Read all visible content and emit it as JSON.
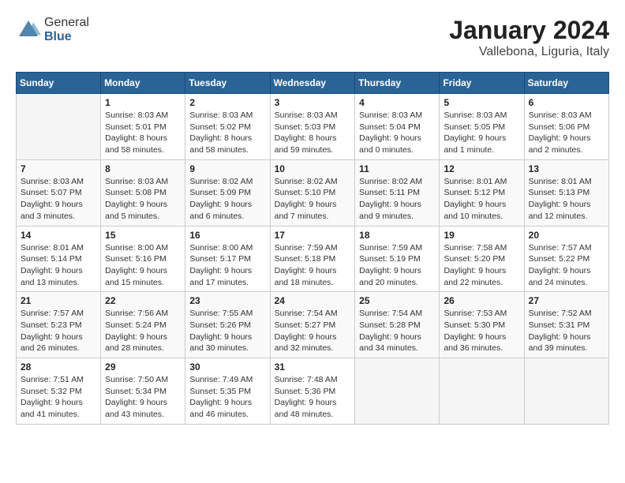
{
  "logo": {
    "general": "General",
    "blue": "Blue"
  },
  "title": "January 2024",
  "location": "Vallebona, Liguria, Italy",
  "days_of_week": [
    "Sunday",
    "Monday",
    "Tuesday",
    "Wednesday",
    "Thursday",
    "Friday",
    "Saturday"
  ],
  "weeks": [
    [
      {
        "day": "",
        "info": ""
      },
      {
        "day": "1",
        "info": "Sunrise: 8:03 AM\nSunset: 5:01 PM\nDaylight: 8 hours\nand 58 minutes."
      },
      {
        "day": "2",
        "info": "Sunrise: 8:03 AM\nSunset: 5:02 PM\nDaylight: 8 hours\nand 58 minutes."
      },
      {
        "day": "3",
        "info": "Sunrise: 8:03 AM\nSunset: 5:03 PM\nDaylight: 8 hours\nand 59 minutes."
      },
      {
        "day": "4",
        "info": "Sunrise: 8:03 AM\nSunset: 5:04 PM\nDaylight: 9 hours\nand 0 minutes."
      },
      {
        "day": "5",
        "info": "Sunrise: 8:03 AM\nSunset: 5:05 PM\nDaylight: 9 hours\nand 1 minute."
      },
      {
        "day": "6",
        "info": "Sunrise: 8:03 AM\nSunset: 5:06 PM\nDaylight: 9 hours\nand 2 minutes."
      }
    ],
    [
      {
        "day": "7",
        "info": "Sunrise: 8:03 AM\nSunset: 5:07 PM\nDaylight: 9 hours\nand 3 minutes."
      },
      {
        "day": "8",
        "info": "Sunrise: 8:03 AM\nSunset: 5:08 PM\nDaylight: 9 hours\nand 5 minutes."
      },
      {
        "day": "9",
        "info": "Sunrise: 8:02 AM\nSunset: 5:09 PM\nDaylight: 9 hours\nand 6 minutes."
      },
      {
        "day": "10",
        "info": "Sunrise: 8:02 AM\nSunset: 5:10 PM\nDaylight: 9 hours\nand 7 minutes."
      },
      {
        "day": "11",
        "info": "Sunrise: 8:02 AM\nSunset: 5:11 PM\nDaylight: 9 hours\nand 9 minutes."
      },
      {
        "day": "12",
        "info": "Sunrise: 8:01 AM\nSunset: 5:12 PM\nDaylight: 9 hours\nand 10 minutes."
      },
      {
        "day": "13",
        "info": "Sunrise: 8:01 AM\nSunset: 5:13 PM\nDaylight: 9 hours\nand 12 minutes."
      }
    ],
    [
      {
        "day": "14",
        "info": "Sunrise: 8:01 AM\nSunset: 5:14 PM\nDaylight: 9 hours\nand 13 minutes."
      },
      {
        "day": "15",
        "info": "Sunrise: 8:00 AM\nSunset: 5:16 PM\nDaylight: 9 hours\nand 15 minutes."
      },
      {
        "day": "16",
        "info": "Sunrise: 8:00 AM\nSunset: 5:17 PM\nDaylight: 9 hours\nand 17 minutes."
      },
      {
        "day": "17",
        "info": "Sunrise: 7:59 AM\nSunset: 5:18 PM\nDaylight: 9 hours\nand 18 minutes."
      },
      {
        "day": "18",
        "info": "Sunrise: 7:59 AM\nSunset: 5:19 PM\nDaylight: 9 hours\nand 20 minutes."
      },
      {
        "day": "19",
        "info": "Sunrise: 7:58 AM\nSunset: 5:20 PM\nDaylight: 9 hours\nand 22 minutes."
      },
      {
        "day": "20",
        "info": "Sunrise: 7:57 AM\nSunset: 5:22 PM\nDaylight: 9 hours\nand 24 minutes."
      }
    ],
    [
      {
        "day": "21",
        "info": "Sunrise: 7:57 AM\nSunset: 5:23 PM\nDaylight: 9 hours\nand 26 minutes."
      },
      {
        "day": "22",
        "info": "Sunrise: 7:56 AM\nSunset: 5:24 PM\nDaylight: 9 hours\nand 28 minutes."
      },
      {
        "day": "23",
        "info": "Sunrise: 7:55 AM\nSunset: 5:26 PM\nDaylight: 9 hours\nand 30 minutes."
      },
      {
        "day": "24",
        "info": "Sunrise: 7:54 AM\nSunset: 5:27 PM\nDaylight: 9 hours\nand 32 minutes."
      },
      {
        "day": "25",
        "info": "Sunrise: 7:54 AM\nSunset: 5:28 PM\nDaylight: 9 hours\nand 34 minutes."
      },
      {
        "day": "26",
        "info": "Sunrise: 7:53 AM\nSunset: 5:30 PM\nDaylight: 9 hours\nand 36 minutes."
      },
      {
        "day": "27",
        "info": "Sunrise: 7:52 AM\nSunset: 5:31 PM\nDaylight: 9 hours\nand 39 minutes."
      }
    ],
    [
      {
        "day": "28",
        "info": "Sunrise: 7:51 AM\nSunset: 5:32 PM\nDaylight: 9 hours\nand 41 minutes."
      },
      {
        "day": "29",
        "info": "Sunrise: 7:50 AM\nSunset: 5:34 PM\nDaylight: 9 hours\nand 43 minutes."
      },
      {
        "day": "30",
        "info": "Sunrise: 7:49 AM\nSunset: 5:35 PM\nDaylight: 9 hours\nand 46 minutes."
      },
      {
        "day": "31",
        "info": "Sunrise: 7:48 AM\nSunset: 5:36 PM\nDaylight: 9 hours\nand 48 minutes."
      },
      {
        "day": "",
        "info": ""
      },
      {
        "day": "",
        "info": ""
      },
      {
        "day": "",
        "info": ""
      }
    ]
  ]
}
